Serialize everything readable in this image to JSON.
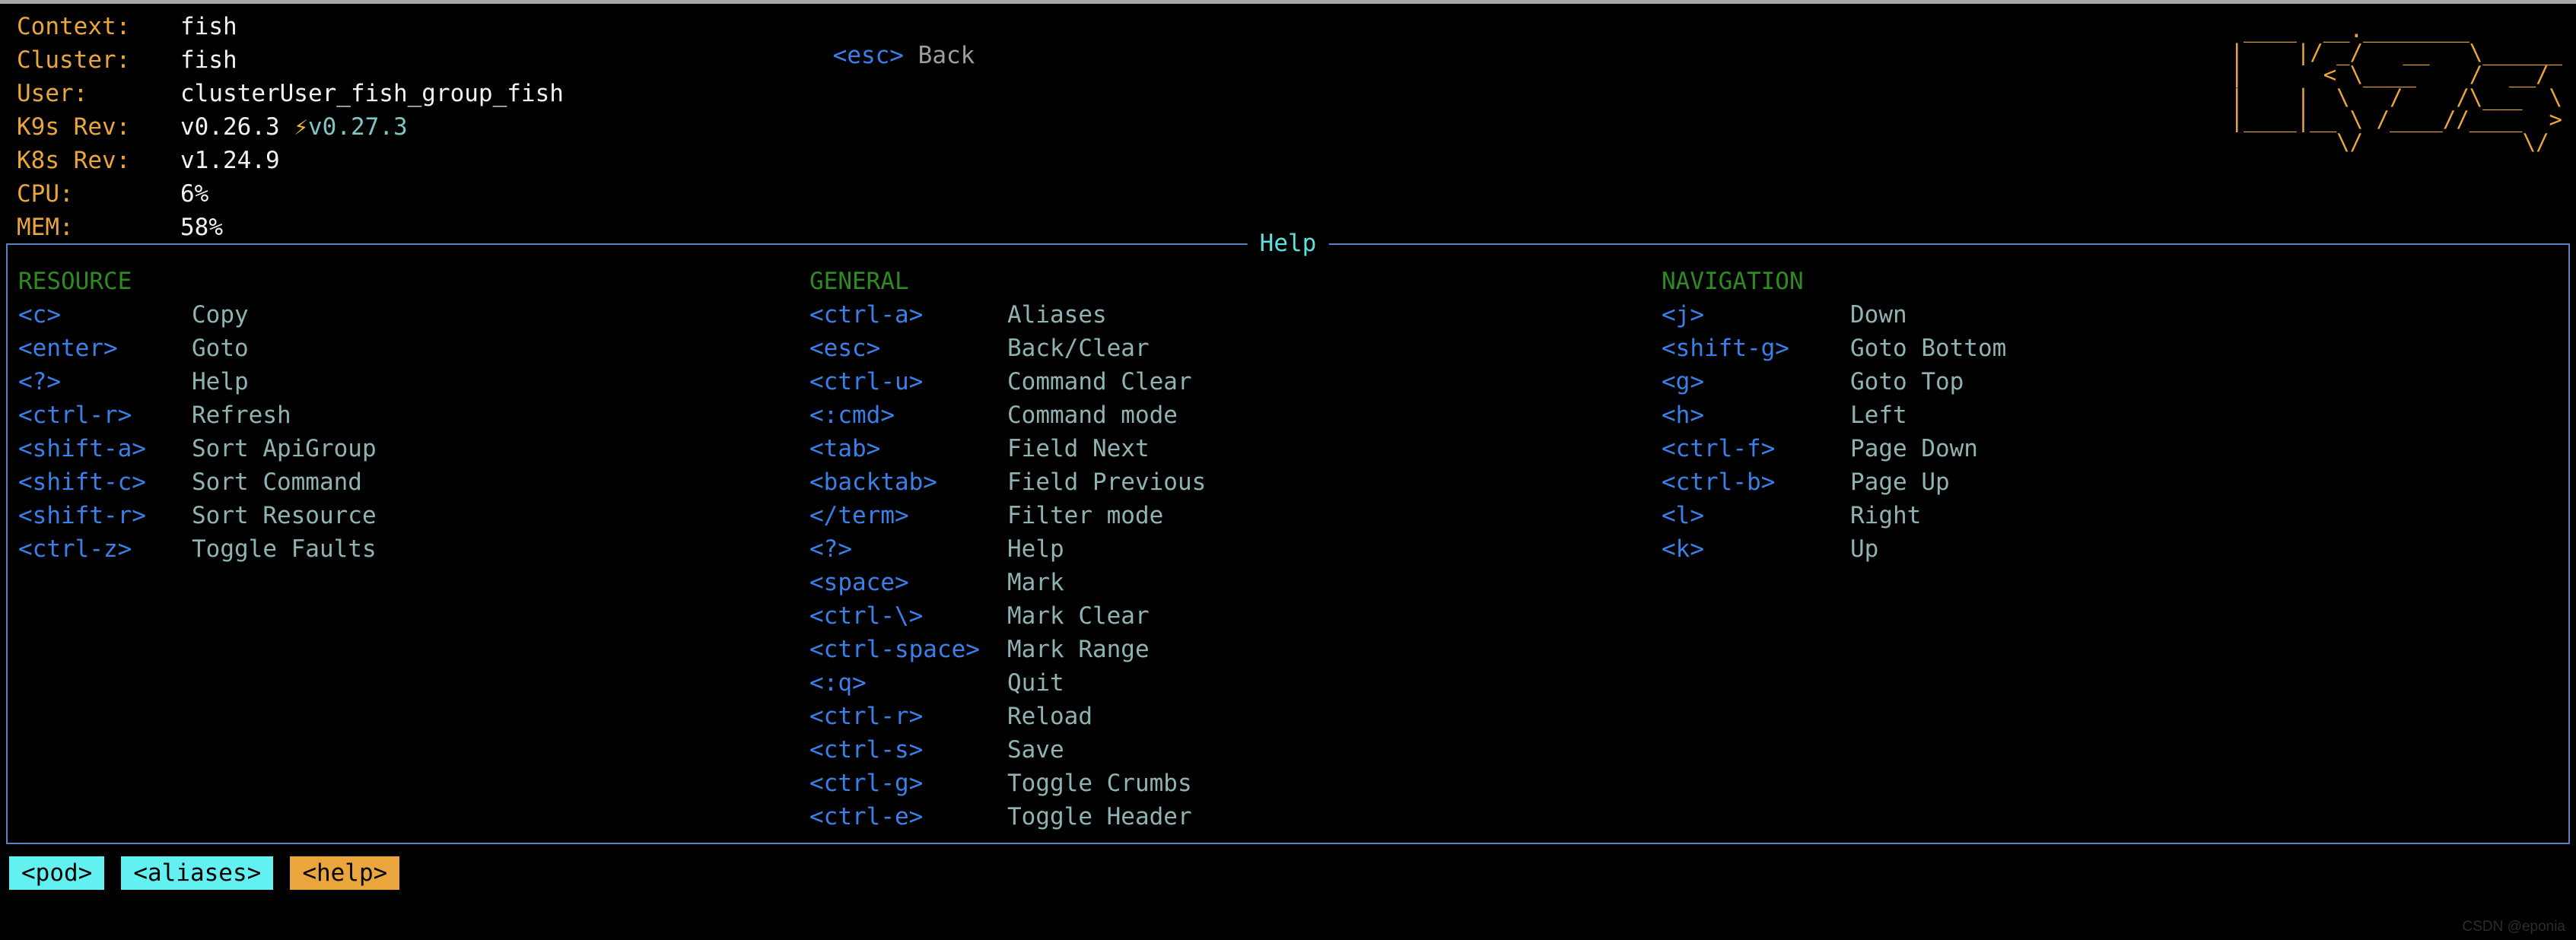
{
  "header": {
    "cluster_info": [
      {
        "label": "Context:",
        "value": "fish"
      },
      {
        "label": "Cluster:",
        "value": "fish"
      },
      {
        "label": "User:",
        "value": "clusterUser_fish_group_fish"
      },
      {
        "label": "K9s Rev:",
        "value": "v0.26.3",
        "bolt": "⚡",
        "new_rev": "v0.27.3"
      },
      {
        "label": "K8s Rev:",
        "value": "v1.24.9"
      },
      {
        "label": "CPU:",
        "value": "6%"
      },
      {
        "label": "MEM:",
        "value": "58%"
      }
    ],
    "esc_hint": {
      "key": "<esc>",
      "desc": "Back"
    },
    "logo_ascii": "  ____  __.________\n |    |/ _/   __   \\______\n |      < \\____    /  __/\n |    |  \\   /    /\\___  \\\n |____|__ \\ /____//____  >\n         \\/            \\/"
  },
  "help": {
    "title": "Help",
    "columns": [
      {
        "name": "RESOURCE",
        "hints": [
          {
            "key": "<c>",
            "desc": "Copy"
          },
          {
            "key": "<enter>",
            "desc": "Goto"
          },
          {
            "key": "<?>",
            "desc": "Help"
          },
          {
            "key": "<ctrl-r>",
            "desc": "Refresh"
          },
          {
            "key": "<shift-a>",
            "desc": "Sort ApiGroup"
          },
          {
            "key": "<shift-c>",
            "desc": "Sort Command"
          },
          {
            "key": "<shift-r>",
            "desc": "Sort Resource"
          },
          {
            "key": "<ctrl-z>",
            "desc": "Toggle Faults"
          }
        ]
      },
      {
        "name": "GENERAL",
        "hints": [
          {
            "key": "<ctrl-a>",
            "desc": "Aliases"
          },
          {
            "key": "<esc>",
            "desc": "Back/Clear"
          },
          {
            "key": "<ctrl-u>",
            "desc": "Command Clear"
          },
          {
            "key": "<:cmd>",
            "desc": "Command mode"
          },
          {
            "key": "<tab>",
            "desc": "Field Next"
          },
          {
            "key": "<backtab>",
            "desc": "Field Previous"
          },
          {
            "key": "</term>",
            "desc": "Filter mode"
          },
          {
            "key": "<?>",
            "desc": "Help"
          },
          {
            "key": "<space>",
            "desc": "Mark"
          },
          {
            "key": "<ctrl-\\>",
            "desc": "Mark Clear"
          },
          {
            "key": "<ctrl-space>",
            "desc": "Mark Range"
          },
          {
            "key": "<:q>",
            "desc": "Quit"
          },
          {
            "key": "<ctrl-r>",
            "desc": "Reload"
          },
          {
            "key": "<ctrl-s>",
            "desc": "Save"
          },
          {
            "key": "<ctrl-g>",
            "desc": "Toggle Crumbs"
          },
          {
            "key": "<ctrl-e>",
            "desc": "Toggle Header"
          }
        ]
      },
      {
        "name": "NAVIGATION",
        "hints": [
          {
            "key": "<j>",
            "desc": "Down"
          },
          {
            "key": "<shift-g>",
            "desc": "Goto Bottom"
          },
          {
            "key": "<g>",
            "desc": "Goto Top"
          },
          {
            "key": "<h>",
            "desc": "Left"
          },
          {
            "key": "<ctrl-f>",
            "desc": "Page Down"
          },
          {
            "key": "<ctrl-b>",
            "desc": "Page Up"
          },
          {
            "key": "<l>",
            "desc": "Right"
          },
          {
            "key": "<k>",
            "desc": "Up"
          }
        ]
      }
    ]
  },
  "crumbs": [
    {
      "label": "<pod>",
      "style": "cyan"
    },
    {
      "label": "<aliases>",
      "style": "cyan"
    },
    {
      "label": "<help>",
      "style": "orange"
    }
  ],
  "watermark": "CSDN @eponia",
  "colors": {
    "background": "#000000",
    "label": "#eba53d",
    "value": "#f2f2f2",
    "key": "#3b7fe8",
    "desc": "#8fb2b2",
    "section_head": "#2e8b22",
    "panel_border": "#5b7fc4",
    "panel_title": "#5ce0e0",
    "crumb_cyan": "#63f0f0",
    "crumb_orange": "#eba53d",
    "new_rev": "#7fc6c6"
  }
}
